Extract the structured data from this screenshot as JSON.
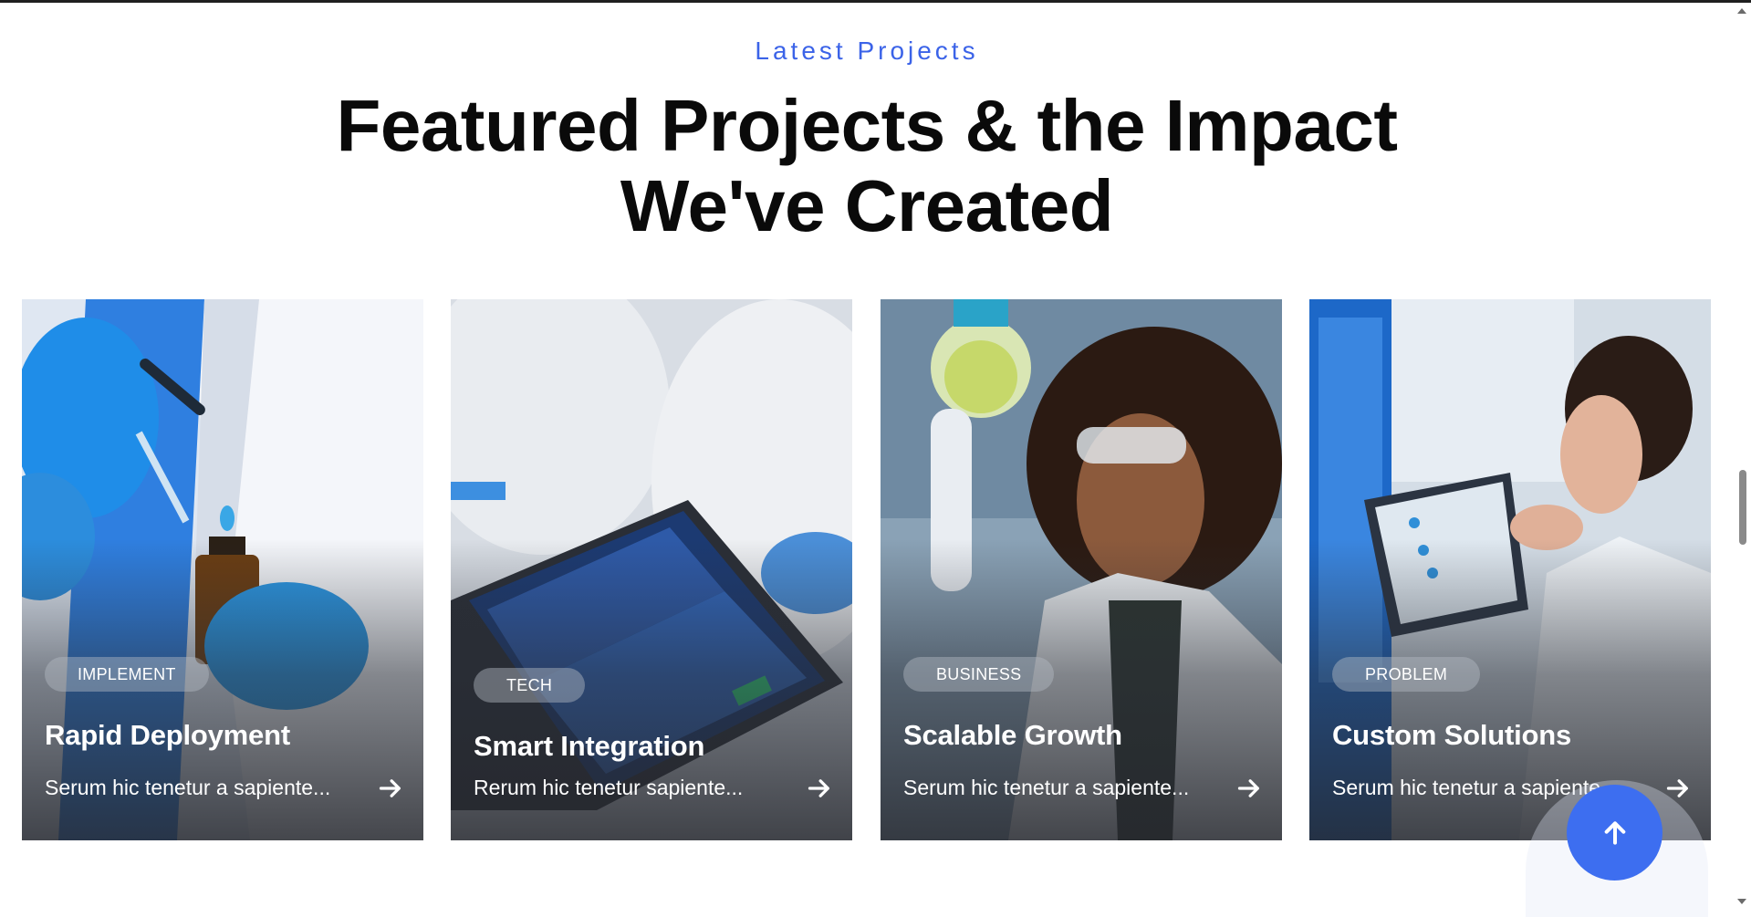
{
  "section": {
    "eyebrow": "Latest Projects",
    "headline": "Featured Projects & the Impact We've Created"
  },
  "projects": [
    {
      "tag": "IMPLEMENT",
      "title": "Rapid Deployment",
      "description": "Serum hic tenetur a sapiente..."
    },
    {
      "tag": "TECH",
      "title": "Smart Integration",
      "description": "Rerum hic tenetur sapiente..."
    },
    {
      "tag": "BUSINESS",
      "title": "Scalable Growth",
      "description": "Serum hic tenetur a sapiente..."
    },
    {
      "tag": "PROBLEM",
      "title": "Custom Solutions",
      "description": "Serum hic tenetur a sapiente..."
    }
  ],
  "icons": {
    "card_arrow": "arrow-right-icon",
    "scroll_top": "arrow-up-icon"
  },
  "colors": {
    "accent": "#3b63e8",
    "scroll_top_button": "#3d6ef0",
    "headline": "#0a0a0a"
  }
}
